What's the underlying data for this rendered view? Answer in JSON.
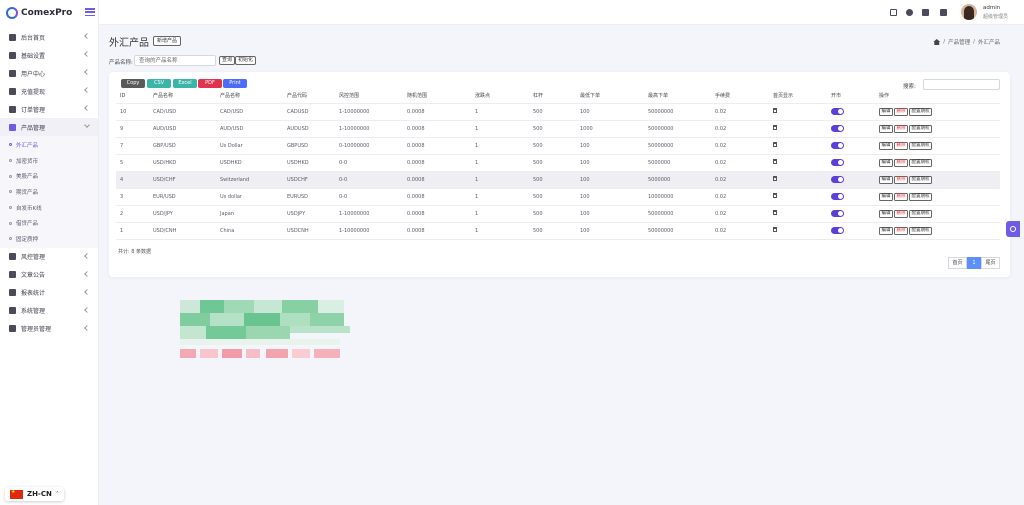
{
  "brand": {
    "name": "ComexPro"
  },
  "sidebar": {
    "items": [
      {
        "label": "后台首页",
        "icon": "home-icon"
      },
      {
        "label": "基础设置",
        "icon": "settings-icon"
      },
      {
        "label": "用户中心",
        "icon": "users-icon"
      },
      {
        "label": "充值提现",
        "icon": "wallet-icon"
      },
      {
        "label": "订单管理",
        "icon": "cart-icon"
      },
      {
        "label": "产品管理",
        "icon": "product-icon"
      },
      {
        "label": "风控管理",
        "icon": "risk-icon"
      },
      {
        "label": "文章公告",
        "icon": "article-icon"
      },
      {
        "label": "报表统计",
        "icon": "report-icon"
      },
      {
        "label": "系统管理",
        "icon": "system-icon"
      },
      {
        "label": "管理员管理",
        "icon": "admin-icon"
      }
    ],
    "product_sub": [
      "外汇产品",
      "加密货币",
      "美股产品",
      "期货产品",
      "自发币K线",
      "借贷产品",
      "固定质押"
    ]
  },
  "language": {
    "label": "ZH-CN"
  },
  "user": {
    "name": "admin",
    "role": "超级管理员"
  },
  "page": {
    "title": "外汇产品",
    "new_button": "新增产品",
    "breadcrumb": [
      "产品管理",
      "外汇产品"
    ],
    "breadcrumb_sep": "/"
  },
  "filter": {
    "label": "产品名称:",
    "placeholder": "查询的产品名称",
    "query_button": "查询",
    "reset_button": "初始化"
  },
  "export_buttons": [
    {
      "label": "Copy",
      "color": "#5a5a5a"
    },
    {
      "label": "CSV",
      "color": "#3ab5a6"
    },
    {
      "label": "Excel",
      "color": "#3ab5a6"
    },
    {
      "label": "PDF",
      "color": "#e0334d"
    },
    {
      "label": "Print",
      "color": "#4a6cf7"
    }
  ],
  "search": {
    "label": "搜索:"
  },
  "table": {
    "headers": [
      "ID",
      "产品名称",
      "产品名称",
      "产品代码",
      "风控范围",
      "随机范围",
      "涨跌点",
      "杠杆",
      "最低下单",
      "最高下单",
      "手续费",
      "首页显示",
      "开市",
      "操作"
    ],
    "actions": {
      "edit": "编辑",
      "delete": "删除",
      "config": "配置期权"
    },
    "rows": [
      [
        "10",
        "CAD/USD",
        "CAD/USD",
        "CADUSD",
        "1-10000000",
        "0.0008",
        "1",
        "500",
        "100",
        "50000000",
        "0.02"
      ],
      [
        "9",
        "AUD/USD",
        "AUD/USD",
        "AUDUSD",
        "1-10000000",
        "0.0008",
        "1",
        "500",
        "1000",
        "50000000",
        "0.02"
      ],
      [
        "7",
        "GBP/USD",
        "Us Dollar",
        "GBPUSD",
        "0-10000000",
        "0.0008",
        "1",
        "500",
        "100",
        "50000000",
        "0.02"
      ],
      [
        "5",
        "USD/HKD",
        "USDHKD",
        "USDHKD",
        "0-0",
        "0.0008",
        "1",
        "500",
        "100",
        "5000000",
        "0.02"
      ],
      [
        "4",
        "USD/CHF",
        "Switzerland",
        "USDCHF",
        "0-0",
        "0.0008",
        "1",
        "500",
        "100",
        "5000000",
        "0.02"
      ],
      [
        "3",
        "EUR/USD",
        "Us dollar",
        "EURUSD",
        "0-0",
        "0.0008",
        "1",
        "500",
        "100",
        "10000000",
        "0.02"
      ],
      [
        "2",
        "USD/JPY",
        "Japan",
        "USDJPY",
        "1-10000000",
        "0.0008",
        "1",
        "500",
        "100",
        "50000000",
        "0.02"
      ],
      [
        "1",
        "USD/CNH",
        "China",
        "USDCNH",
        "1-10000000",
        "0.0008",
        "1",
        "500",
        "100",
        "50000000",
        "0.02"
      ]
    ]
  },
  "summary": {
    "total": "共计: 8 条数据"
  },
  "pagination": {
    "prev": "首页",
    "current": "1",
    "next": "尾页"
  },
  "colors": {
    "accent": "#6e5ce6",
    "toggle": "#5b3fd6"
  }
}
